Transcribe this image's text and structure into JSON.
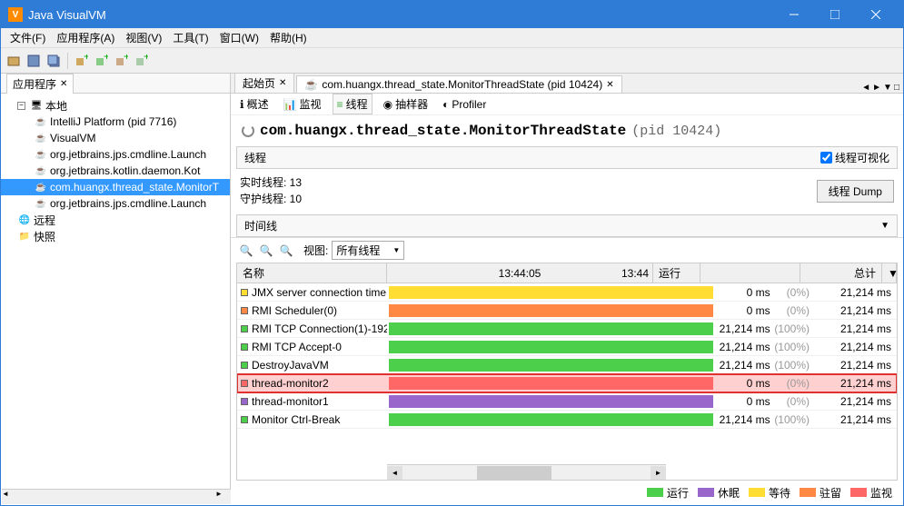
{
  "window": {
    "title": "Java VisualVM"
  },
  "menu": {
    "file": "文件(F)",
    "app": "应用程序(A)",
    "view": "视图(V)",
    "tool": "工具(T)",
    "window": "窗口(W)",
    "help": "帮助(H)"
  },
  "sidebar": {
    "tab": "应用程序",
    "local": "本地",
    "remote": "远程",
    "snapshot": "快照",
    "items": [
      {
        "label": "IntelliJ Platform (pid 7716)"
      },
      {
        "label": "VisualVM"
      },
      {
        "label": "org.jetbrains.jps.cmdline.Launch"
      },
      {
        "label": "org.jetbrains.kotlin.daemon.Kot"
      },
      {
        "label": "com.huangx.thread_state.MonitorT"
      },
      {
        "label": "org.jetbrains.jps.cmdline.Launch"
      }
    ]
  },
  "tabs": {
    "start": "起始页",
    "main": "com.huangx.thread_state.MonitorThreadState (pid 10424)",
    "sub": {
      "overview": "概述",
      "monitor": "监视",
      "threads": "线程",
      "sampler": "抽样器",
      "profiler": "Profiler"
    }
  },
  "header": {
    "title": "com.huangx.thread_state.MonitorThreadState",
    "pid": "(pid 10424)"
  },
  "section": {
    "threads": "线程",
    "vis": "线程可视化"
  },
  "stats": {
    "live_l": "实时线程: ",
    "live_v": "13",
    "daemon_l": "守护线程: ",
    "daemon_v": "10",
    "dump": "线程 Dump"
  },
  "timeline": {
    "label": "时间线",
    "view_l": "视图:",
    "view_v": "所有线程",
    "t1": "13:44:05",
    "t2": "13:44"
  },
  "cols": {
    "name": "名称",
    "run": "运行",
    "total": "总计"
  },
  "rows": [
    {
      "name": "JMX server connection time",
      "sw": "yellow",
      "bar": "yellow",
      "run": "0 ms",
      "pct": "(0%)",
      "tot": "21,214 ms",
      "hl": false
    },
    {
      "name": "RMI Scheduler(0)",
      "sw": "ored",
      "bar": "ored",
      "run": "0 ms",
      "pct": "(0%)",
      "tot": "21,214 ms",
      "hl": false
    },
    {
      "name": "RMI TCP Connection(1)-192.",
      "sw": "green",
      "bar": "green",
      "run": "21,214 ms",
      "pct": "(100%)",
      "tot": "21,214 ms",
      "hl": false
    },
    {
      "name": "RMI TCP Accept-0",
      "sw": "green",
      "bar": "green",
      "run": "21,214 ms",
      "pct": "(100%)",
      "tot": "21,214 ms",
      "hl": false
    },
    {
      "name": "DestroyJavaVM",
      "sw": "green",
      "bar": "green",
      "run": "21,214 ms",
      "pct": "(100%)",
      "tot": "21,214 ms",
      "hl": false
    },
    {
      "name": "thread-monitor2",
      "sw": "salmon",
      "bar": "salmon",
      "run": "0 ms",
      "pct": "(0%)",
      "tot": "21,214 ms",
      "hl": true
    },
    {
      "name": "thread-monitor1",
      "sw": "purple",
      "bar": "purple",
      "run": "0 ms",
      "pct": "(0%)",
      "tot": "21,214 ms",
      "hl": false
    },
    {
      "name": "Monitor Ctrl-Break",
      "sw": "green",
      "bar": "green",
      "run": "21,214 ms",
      "pct": "(100%)",
      "tot": "21,214 ms",
      "hl": false
    }
  ],
  "legend": {
    "run": "运行",
    "sleep": "休眠",
    "wait": "等待",
    "park": "驻留",
    "mon": "监视"
  }
}
